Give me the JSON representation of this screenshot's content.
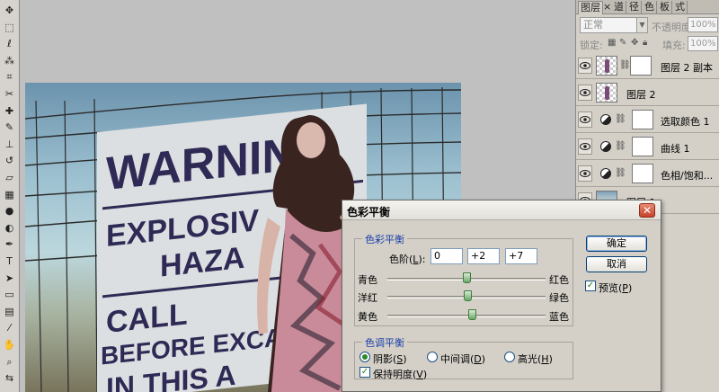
{
  "tools": [
    {
      "name": "move-tool",
      "glyph": "✥"
    },
    {
      "name": "marquee-tool",
      "glyph": "⬚"
    },
    {
      "name": "lasso-tool",
      "glyph": "ℓ"
    },
    {
      "name": "magic-wand-tool",
      "glyph": "⁂"
    },
    {
      "name": "crop-tool",
      "glyph": "⌗"
    },
    {
      "name": "slice-tool",
      "glyph": "✂"
    },
    {
      "name": "healing-brush-tool",
      "glyph": "✚"
    },
    {
      "name": "brush-tool",
      "glyph": "✎"
    },
    {
      "name": "clone-stamp-tool",
      "glyph": "⊥"
    },
    {
      "name": "history-brush-tool",
      "glyph": "↺"
    },
    {
      "name": "eraser-tool",
      "glyph": "▱"
    },
    {
      "name": "gradient-tool",
      "glyph": "▦"
    },
    {
      "name": "blur-tool",
      "glyph": "●"
    },
    {
      "name": "dodge-tool",
      "glyph": "◐"
    },
    {
      "name": "pen-tool",
      "glyph": "✒"
    },
    {
      "name": "type-tool",
      "glyph": "T"
    },
    {
      "name": "path-selection-tool",
      "glyph": "➤"
    },
    {
      "name": "shape-tool",
      "glyph": "▭"
    },
    {
      "name": "notes-tool",
      "glyph": "▤"
    },
    {
      "name": "eyedropper-tool",
      "glyph": "⁄"
    },
    {
      "name": "hand-tool",
      "glyph": "✋"
    },
    {
      "name": "zoom-tool",
      "glyph": "⌕"
    },
    {
      "name": "color-swap-tool",
      "glyph": "⇆"
    }
  ],
  "photo": {
    "sign_lines": [
      "WARNIN",
      "EXPLOSIV",
      "HAZA",
      "CALL",
      "BEFORE EXCAVA",
      "IN THIS A"
    ]
  },
  "layers_panel": {
    "tabs": [
      "图层",
      "×",
      "道",
      "径",
      "色",
      "板",
      "式"
    ],
    "blend_mode": "正常",
    "opacity_label": "不透明度:",
    "opacity_value": "100%",
    "lock_label": "锁定:",
    "fill_label": "填充:",
    "fill_value": "100%",
    "layers": [
      {
        "name": "图层 2 副本",
        "type": "pixel-with-mask",
        "selected": true
      },
      {
        "name": "图层 2",
        "type": "pixel",
        "selected": false
      },
      {
        "name": "选取颜色 1",
        "type": "adjustment",
        "selected": false
      },
      {
        "name": "曲线 1",
        "type": "adjustment",
        "selected": false
      },
      {
        "name": "色相/饱和...",
        "type": "adjustment",
        "selected": false
      },
      {
        "name": "图层 1",
        "type": "photo",
        "selected": false
      }
    ]
  },
  "dialog": {
    "title": "色彩平衡",
    "color_balance_group": "色彩平衡",
    "levels_label": "色阶(",
    "levels_key": "L",
    "levels_suffix": "):",
    "levels": [
      "0",
      "+2",
      "+7"
    ],
    "sliders": [
      {
        "left": "青色",
        "right": "红色",
        "value": 0
      },
      {
        "left": "洋红",
        "right": "绿色",
        "value": 2
      },
      {
        "left": "黄色",
        "right": "蓝色",
        "value": 7
      }
    ],
    "tone_group": "色调平衡",
    "tones": [
      {
        "label": "阴影(",
        "key": "S",
        "suffix": ")",
        "selected": true
      },
      {
        "label": "中间调(",
        "key": "D",
        "suffix": ")",
        "selected": false
      },
      {
        "label": "高光(",
        "key": "H",
        "suffix": ")",
        "selected": false
      }
    ],
    "preserve_label": "保持明度(",
    "preserve_key": "V",
    "preserve_suffix": ")",
    "preserve_checked": true,
    "ok_label": "确定",
    "cancel_label": "取消",
    "preview_label": "预览(",
    "preview_key": "P",
    "preview_suffix": ")",
    "preview_checked": true
  }
}
